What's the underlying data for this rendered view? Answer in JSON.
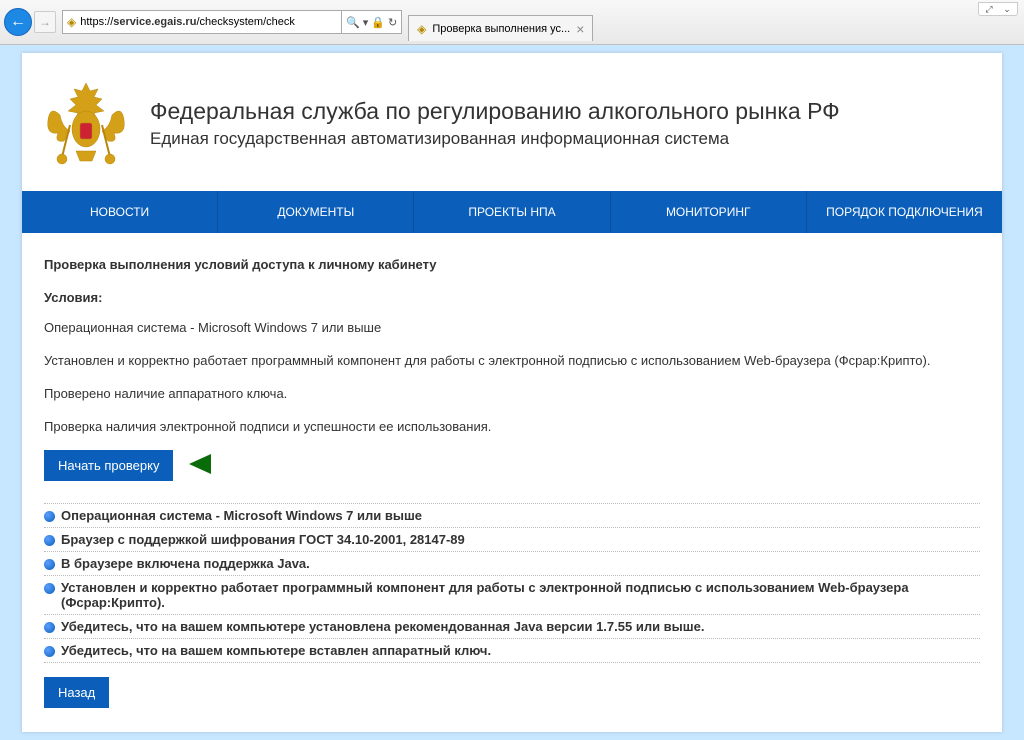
{
  "browser": {
    "url_display": "https://service.egais.ru/checksystem/check",
    "url_bold_part": "service.egais.ru",
    "tab_title": "Проверка выполнения ус...",
    "search_icon": "🔍",
    "refresh_icon": "↻",
    "lock_icon": "🔒"
  },
  "site": {
    "title": "Федеральная служба по регулированию алкогольного рынка РФ",
    "subtitle": "Единая государственная автоматизированная информационная система"
  },
  "nav": {
    "items": [
      "НОВОСТИ",
      "ДОКУМЕНТЫ",
      "ПРОЕКТЫ НПА",
      "МОНИТОРИНГ",
      "ПОРЯДОК ПОДКЛЮЧЕНИЯ"
    ]
  },
  "content": {
    "heading": "Проверка выполнения условий доступа к личному кабинету",
    "conditions_label": "Условия:",
    "conditions": [
      "Операционная система - Microsoft Windows 7 или выше",
      "Установлен и корректно работает программный компонент для работы с электронной подписью с использованием Web-браузера (Фсрар:Крипто).",
      "Проверено наличие аппаратного ключа.",
      "Проверка наличия электронной подписи и успешности ее использования."
    ],
    "start_check_btn": "Начать проверку",
    "back_btn": "Назад",
    "checklist": [
      "Операционная система - Microsoft Windows 7 или выше",
      "Браузер с поддержкой шифрования ГОСТ 34.10-2001, 28147-89",
      "В браузере включена поддержка Java.",
      "Установлен и корректно работает программный компонент для работы с электронной подписью с использованием Web-браузера (Фсрар:Крипто).",
      "Убедитесь, что на вашем компьютере установлена рекомендованная Java версии 1.7.55 или выше.",
      "Убедитесь, что на вашем компьютере вставлен аппаратный ключ."
    ]
  }
}
